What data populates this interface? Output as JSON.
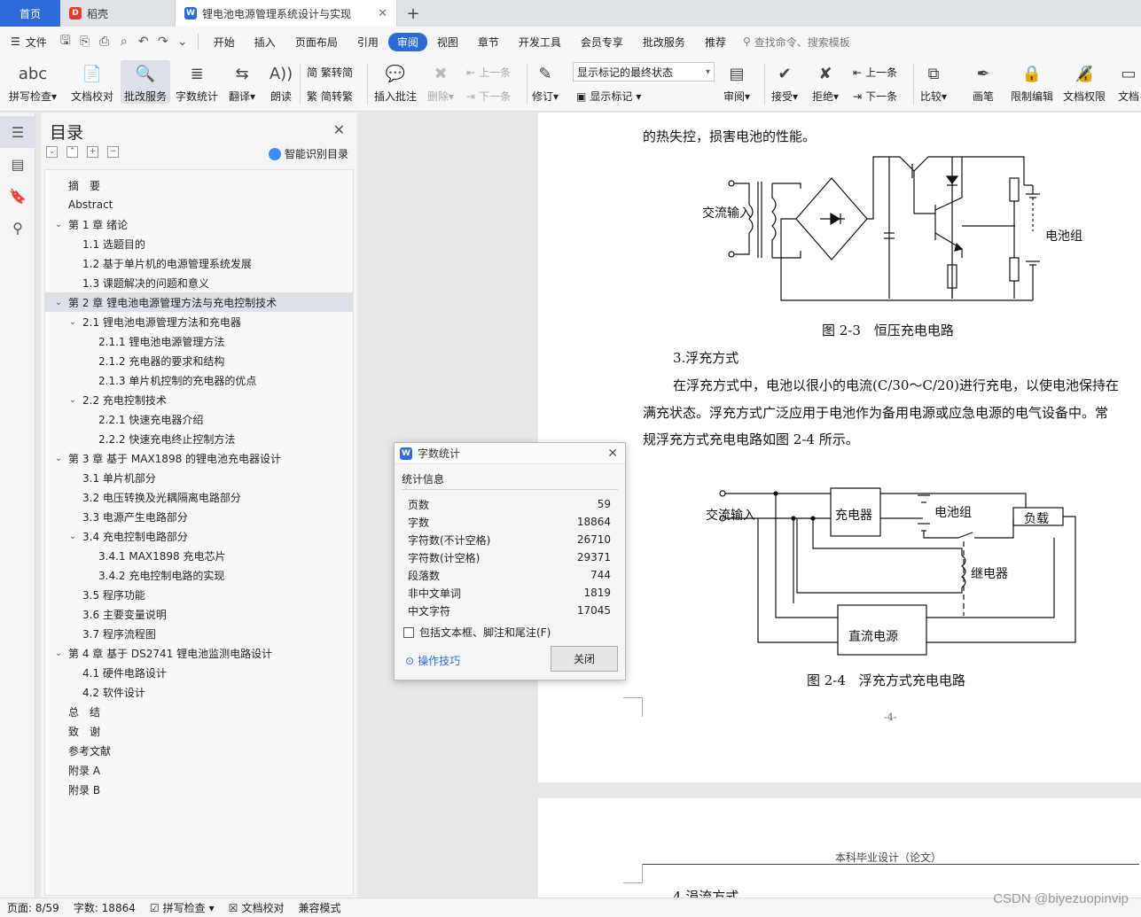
{
  "tabs": {
    "home": "首页",
    "docer": "稻壳",
    "active_doc": "锂电池电源管理系统设计与实现"
  },
  "menubar": {
    "file": "文件",
    "items": [
      "开始",
      "插入",
      "页面布局",
      "引用",
      "审阅",
      "视图",
      "章节",
      "开发工具",
      "会员专享",
      "批改服务",
      "推荐"
    ],
    "active": "审阅",
    "search": "查找命令、搜索模板"
  },
  "ribbon": {
    "spell": "拼写检查",
    "doc_check": "文档校对",
    "review_service": "批改服务",
    "word_count": "字数统计",
    "translate": "翻译",
    "read_aloud": "朗读",
    "trad_to_simp": "繁转简",
    "simp_to_trad": "简转繁",
    "insert_comment": "插入批注",
    "delete": "删除",
    "prev": "上一条",
    "next": "下一条",
    "track": "修订",
    "display_state": "显示标记的最终状态",
    "show_markup": "显示标记",
    "review": "审阅",
    "accept": "接受",
    "reject": "拒绝",
    "prev2": "上一条",
    "next2": "下一条",
    "compare": "比较",
    "pen": "画笔",
    "restrict_edit": "限制编辑",
    "doc_permission": "文档权限",
    "doc_more": "文档"
  },
  "toc": {
    "title": "目录",
    "smart": "智能识别目录",
    "items": [
      {
        "label": "摘　要",
        "level": 0,
        "chev": ""
      },
      {
        "label": "Abstract",
        "level": 0,
        "chev": ""
      },
      {
        "label": "第 1 章  绪论",
        "level": 0,
        "chev": "v"
      },
      {
        "label": "1.1  选题目的",
        "level": 1,
        "chev": ""
      },
      {
        "label": "1.2  基于单片机的电源管理系统发展",
        "level": 1,
        "chev": ""
      },
      {
        "label": "1.3  课题解决的问题和意义",
        "level": 1,
        "chev": ""
      },
      {
        "label": "第 2 章  锂电池电源管理方法与充电控制技术",
        "level": 0,
        "chev": "v",
        "selected": true
      },
      {
        "label": "2.1  锂电池电源管理方法和充电器",
        "level": 1,
        "chev": "v"
      },
      {
        "label": "2.1.1 锂电池电源管理方法",
        "level": 2,
        "chev": ""
      },
      {
        "label": "2.1.2 充电器的要求和结构",
        "level": 2,
        "chev": ""
      },
      {
        "label": "2.1.3 单片机控制的充电器的优点",
        "level": 2,
        "chev": ""
      },
      {
        "label": "2.2  充电控制技术",
        "level": 1,
        "chev": "v"
      },
      {
        "label": "2.2.1  快速充电器介绍",
        "level": 2,
        "chev": ""
      },
      {
        "label": "2.2.2  快速充电终止控制方法",
        "level": 2,
        "chev": ""
      },
      {
        "label": " 第 3 章  基于 MAX1898 的锂电池充电器设计",
        "level": 0,
        "chev": "v"
      },
      {
        "label": "3.1  单片机部分",
        "level": 1,
        "chev": ""
      },
      {
        "label": "3.2  电压转换及光耦隔离电路部分",
        "level": 1,
        "chev": ""
      },
      {
        "label": "3.3  电源产生电路部分",
        "level": 1,
        "chev": ""
      },
      {
        "label": "3.4  充电控制电路部分",
        "level": 1,
        "chev": "v"
      },
      {
        "label": "3.4.1 MAX1898 充电芯片",
        "level": 2,
        "chev": ""
      },
      {
        "label": "3.4.2 充电控制电路的实现",
        "level": 2,
        "chev": ""
      },
      {
        "label": "3.5  程序功能",
        "level": 1,
        "chev": ""
      },
      {
        "label": "3.6  主要变量说明",
        "level": 1,
        "chev": ""
      },
      {
        "label": "3.7  程序流程图",
        "level": 1,
        "chev": ""
      },
      {
        "label": "第 4 章  基于 DS2741 锂电池监测电路设计",
        "level": 0,
        "chev": "v"
      },
      {
        "label": "4.1  硬件电路设计",
        "level": 1,
        "chev": ""
      },
      {
        "label": "4.2  软件设计",
        "level": 1,
        "chev": ""
      },
      {
        "label": "总　结",
        "level": 0,
        "chev": ""
      },
      {
        "label": "致　谢",
        "level": 0,
        "chev": ""
      },
      {
        "label": "参考文献",
        "level": 0,
        "chev": ""
      },
      {
        "label": "附录 A",
        "level": 0,
        "chev": ""
      },
      {
        "label": "附录 B",
        "level": 0,
        "chev": ""
      }
    ]
  },
  "doc": {
    "line_top": "的热失控，损害电池的性能。",
    "fig23_input": "交流输入",
    "fig23_battery": "电池组",
    "fig23_caption": "图 2-3　恒压充电电路",
    "heading3": "3.浮充方式",
    "para1": "在浮充方式中，电池以很小的电流(C/30～C/20)进行充电，以使电池保持在",
    "para2": "满充状态。浮充方式广泛应用于电池作为备用电源或应急电源的电气设备中。常",
    "para3": "规浮充方式充电电路如图 2-4 所示。",
    "fig24_input": "交流输入",
    "fig24_charger": "充电器",
    "fig24_battery": "电池组",
    "fig24_load": "负载",
    "fig24_relay": "继电器",
    "fig24_dc": "直流电源",
    "fig24_caption": "图 2-4　浮充方式充电电路",
    "page_number": "-4-",
    "page2_header": "本科毕业设计（论文）",
    "page2_text": "4.涓流方式"
  },
  "dialog": {
    "title": "字数统计",
    "section": "统计信息",
    "stats": [
      {
        "label": "页数",
        "value": "59"
      },
      {
        "label": "字数",
        "value": "18864"
      },
      {
        "label": "字符数(不计空格)",
        "value": "26710"
      },
      {
        "label": "字符数(计空格)",
        "value": "29371"
      },
      {
        "label": "段落数",
        "value": "744"
      },
      {
        "label": "非中文单词",
        "value": "1819"
      },
      {
        "label": "中文字符",
        "value": "17045"
      }
    ],
    "include_label": "包括文本框、脚注和尾注(F)",
    "tips": "操作技巧",
    "close": "关闭"
  },
  "statusbar": {
    "page": "页面: 8/59",
    "words": "字数: 18864",
    "spell": "拼写检查",
    "doc_check": "文档校对",
    "compat": "兼容模式"
  },
  "watermark": "CSDN @biyezuopinvip"
}
